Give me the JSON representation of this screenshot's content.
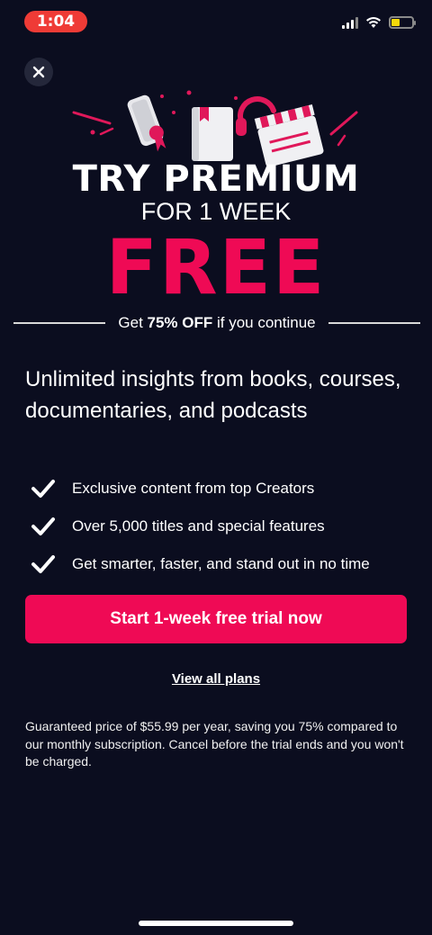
{
  "status": {
    "time": "1:04"
  },
  "header": {
    "close_icon": "close-icon"
  },
  "hero": {
    "title_line1": "TRY PREMIUM",
    "title_line2": "FOR 1 WEEK",
    "title_free": "FREE",
    "accent_color": "#ef0a55"
  },
  "offer": {
    "prefix": "Get ",
    "discount": "75% OFF",
    "suffix": " if you continue"
  },
  "headline": "Unlimited insights from books, courses, documentaries, and podcasts",
  "features": [
    {
      "label": "Exclusive content from top Creators",
      "icon": "check-icon"
    },
    {
      "label": "Over 5,000 titles and special features",
      "icon": "check-icon"
    },
    {
      "label": "Get smarter, faster, and stand out in no time",
      "icon": "check-icon"
    }
  ],
  "cta": {
    "label": "Start 1-week free trial now"
  },
  "plans_link": "View all plans",
  "disclaimer": "Guaranteed price of $55.99 per year, saving you 75% compared to our monthly subscription. Cancel before the trial ends and you won't be charged."
}
